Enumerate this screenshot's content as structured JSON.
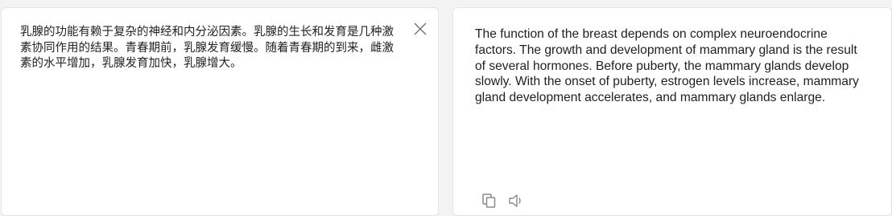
{
  "source_panel": {
    "text": "乳腺的功能有赖于复杂的神经和内分泌因素。乳腺的生长和发育是几种激素协同作用的结果。青春期前，乳腺发育缓慢。随着青春期的到来，雌激素的水平增加，乳腺发育加快，乳腺增大。",
    "close_icon": "close-icon"
  },
  "target_panel": {
    "text": "The function of the breast depends on complex neuroendocrine factors. The growth and development of mammary gland is the result of several hormones. Before puberty, the mammary glands develop slowly. With the onset of puberty, estrogen levels increase, mammary gland development accelerates, and mammary glands enlarge.",
    "copy_icon": "copy-icon",
    "speaker_icon": "speaker-icon"
  },
  "colors": {
    "background": "#f3f3f3",
    "panel": "#ffffff",
    "text": "#222222",
    "icon": "#8a8a8a"
  }
}
